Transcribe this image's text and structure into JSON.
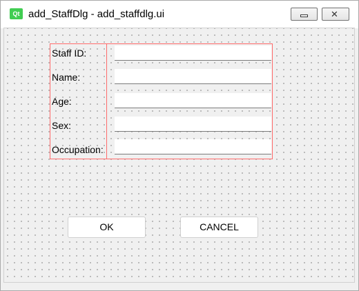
{
  "window": {
    "title": "add_StaffDlg - add_staffdlg.ui",
    "icon_label": "Qt",
    "icon_color": "#41cd52"
  },
  "form": {
    "fields": [
      {
        "label": "Staff ID:",
        "value": ""
      },
      {
        "label": "Name:",
        "value": ""
      },
      {
        "label": "Age:",
        "value": ""
      },
      {
        "label": "Sex:",
        "value": ""
      },
      {
        "label": "Occupation:",
        "value": ""
      }
    ]
  },
  "buttons": {
    "ok_label": "OK",
    "cancel_label": "CANCEL"
  },
  "colors": {
    "layout_frame": "#ff6b6b",
    "background": "#f0f0f0"
  }
}
